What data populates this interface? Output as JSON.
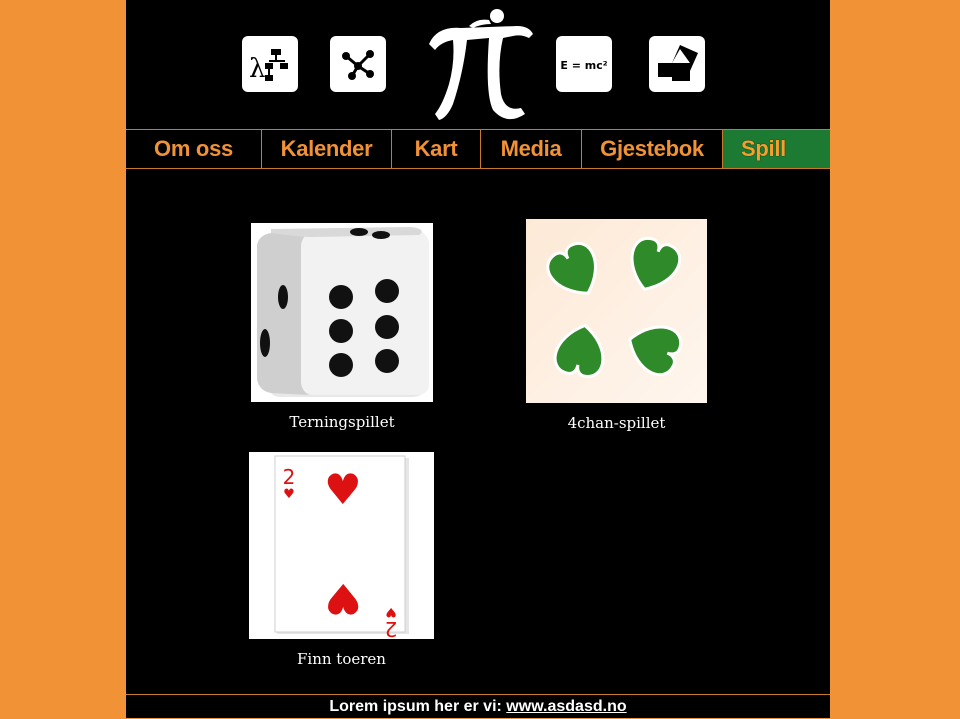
{
  "banner": {
    "icons": [
      "lambda-flowchart-icon",
      "graph-nodes-icon",
      "pi-logo",
      "emc2-icon",
      "pythagoras-squares-icon"
    ],
    "emc2_text": "E = mc²",
    "lambda_text": "λ"
  },
  "nav": {
    "items": [
      {
        "label": "Om oss"
      },
      {
        "label": "Kalender"
      },
      {
        "label": "Kart"
      },
      {
        "label": "Media"
      },
      {
        "label": "Gjestebok"
      },
      {
        "label": "Spill",
        "active": true
      }
    ],
    "active_color": "#1c7a32",
    "text_color": "#f09235"
  },
  "games": [
    {
      "label": "Terningspillet",
      "image": "dice-image"
    },
    {
      "label": "4chan-spillet",
      "image": "clover-image"
    },
    {
      "label": "Finn toeren",
      "image": "playing-card-image"
    }
  ],
  "card": {
    "rank": "2"
  },
  "footer": {
    "text": "Lorem ipsum her er vi: ",
    "link": "www.asdasd.no"
  },
  "colors": {
    "background": "#f09235",
    "page": "#000000"
  }
}
